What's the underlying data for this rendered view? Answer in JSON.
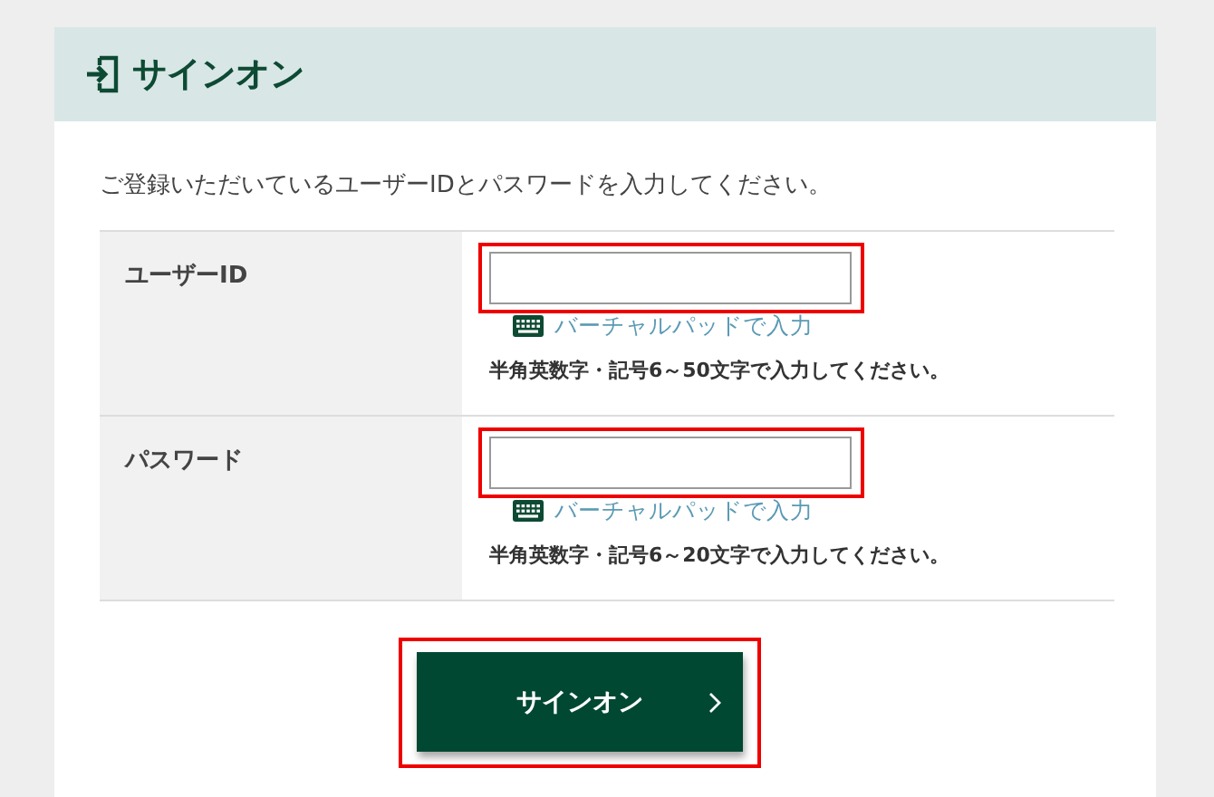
{
  "title": "サインオン",
  "intro": "ご登録いただいているユーザーIDとパスワードを入力してください。",
  "fields": [
    {
      "label": "ユーザーID",
      "pad_link": "バーチャルパッドで入力",
      "hint": "半角英数字・記号6～50文字で入力してください。",
      "highlighted": true
    },
    {
      "label": "パスワード",
      "pad_link": "バーチャルパッドで入力",
      "hint": "半角英数字・記号6～20文字で入力してください。",
      "highlighted": true
    }
  ],
  "submit": {
    "label": "サインオン",
    "highlighted": true
  }
}
